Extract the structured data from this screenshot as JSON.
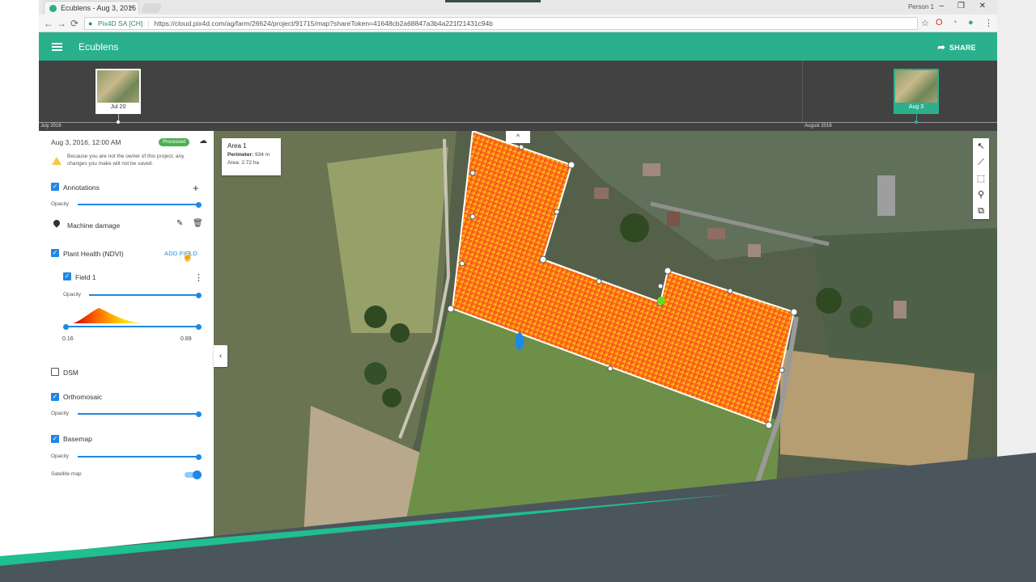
{
  "browser": {
    "tab_title": "Ecublens - Aug 3, 2016",
    "tab_close": "×",
    "user_name": "Person 1",
    "win_min": "–",
    "win_max": "❐",
    "win_close": "✕",
    "nav_back": "←",
    "nav_forward": "→",
    "nav_reload": "⟳",
    "secure_label": "Pix4D SA [CH]",
    "url": "https://cloud.pix4d.com/ag/farm/26624/project/91715/map?shareToken=41648cb2a68847a3b4a221f21431c94b",
    "star_icon": "☆",
    "menu_icon": "⋮"
  },
  "app": {
    "title": "Ecublens",
    "share_label": "SHARE",
    "accent_color": "#2ab08d"
  },
  "timeline": {
    "month_left": "July 2016",
    "month_right": "August 2016",
    "thumbs": [
      {
        "label": "Jul 20"
      },
      {
        "label": "Aug 3"
      }
    ]
  },
  "sidebar": {
    "date": "Aug 3, 2016, 12:00 AM",
    "status_badge": "Processed",
    "warning": "Because you are not the owner of this project, any changes you make will not be saved.",
    "annotations_label": "Annotations",
    "opacity_label": "Opacity",
    "annotation_item": "Machine damage",
    "plant_health_label": "Plant Health (NDVI)",
    "add_field_label": "ADD FIELD",
    "field_label": "Field 1",
    "range_min": "0.16",
    "range_max": "0.89",
    "dsm_label": "DSM",
    "orthomosaic_label": "Orthomosaic",
    "basemap_label": "Basemap",
    "satellite_label": "Satellite map",
    "checkmark": "✓",
    "plus_icon": "+",
    "edit_icon": "✎",
    "trash_icon": "🗑",
    "kebab_icon": "⋮",
    "cloud_icon": "☁"
  },
  "map": {
    "collapse_icon": "‹",
    "expand_up_icon": "^",
    "area_title": "Area 1",
    "perimeter_label": "Perimeter:",
    "perimeter_value": "934 m",
    "area_label": "Area:",
    "area_value": "2.72 ha",
    "tools": [
      "↖",
      "⟋",
      "⬚",
      "⚲",
      "⧉"
    ]
  }
}
